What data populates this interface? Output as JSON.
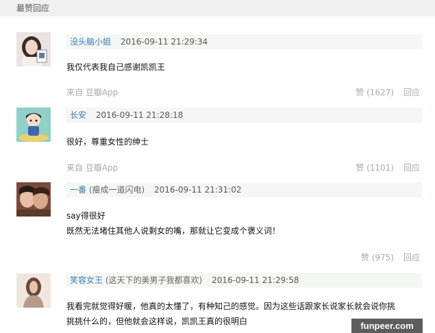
{
  "section_title": "最赞回应",
  "comments": [
    {
      "username": "没头脑小姐",
      "signature": "",
      "timestamp": "2016-09-11 21:29:34",
      "lines": [
        "我仅代表我自己感谢凯凯王"
      ],
      "source": "来自 豆瓣App",
      "likes": "赞 (1627)",
      "reply": "回应"
    },
    {
      "username": "长安",
      "signature": "",
      "timestamp": "2016-09-11 21:28:18",
      "lines": [
        "很好，尊重女性的绅士"
      ],
      "source": "来自 豆瓣App",
      "likes": "赞 (1101)",
      "reply": "回应"
    },
    {
      "username": "一番",
      "signature": "(瘦成一道闪电)",
      "timestamp": "2016-09-11 21:31:02",
      "lines": [
        "say得很好",
        "既然无法堵住其他人说剩女的嘴，那就让它变成个褒义词！"
      ],
      "source": "",
      "likes": "赞 (975)",
      "reply": "回应"
    },
    {
      "username": "笑容女王",
      "signature": "(这天下的美男子我都喜欢)",
      "timestamp": "2016-09-11 21:29:58",
      "lines": [
        "我看完就觉得好暖，他真的太懂了，有种知己的感觉。因为这些话跟家长说家长就会说你挑",
        "挑挑什么的，但他就会这样说，凯凯王真的很明白"
      ],
      "source": "",
      "likes": "",
      "reply": ""
    }
  ],
  "watermark": "funpeer.com",
  "colors": {
    "username": "#3b7fb3",
    "meta_bg": "#f4f7f4",
    "header_bg": "#f0f0f0",
    "muted": "#a8a8a8"
  }
}
